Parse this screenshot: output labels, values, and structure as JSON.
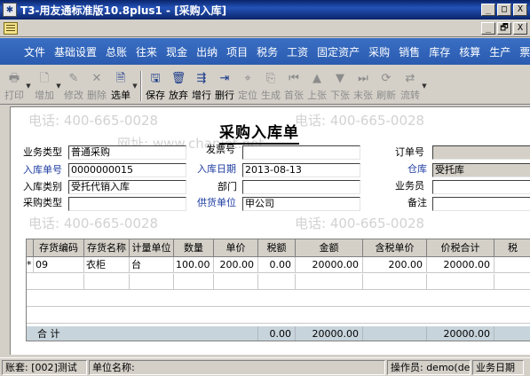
{
  "window": {
    "title": "T3-用友通标准版10.8plus1 - [采购入库]",
    "icon_name": "app-icon",
    "btn_min": "_",
    "btn_max": "□",
    "btn_close": "X"
  },
  "mdi": {
    "btn_min": "_",
    "btn_restore": "🗗",
    "btn_close": "X"
  },
  "menu": [
    "文件",
    "基础设置",
    "总账",
    "往来",
    "现金",
    "出纳",
    "项目",
    "税务",
    "工资",
    "固定资产",
    "采购",
    "销售",
    "库存",
    "核算",
    "生产",
    "票据"
  ],
  "toolbar": {
    "print": "打印",
    "add": "增加",
    "modify": "修改",
    "delete": "删除",
    "select": "选单",
    "save": "保存",
    "abandon": "放弃",
    "add_row": "增行",
    "delete_row": "删行",
    "locate": "定位",
    "generate": "生成",
    "first": "首张",
    "prev": "上张",
    "next": "下张",
    "last": "末张",
    "refresh": "刷新",
    "flow": "流转"
  },
  "watermark": {
    "phone": "电话: 400-665-0028",
    "site": "网址: www.chanjet.net"
  },
  "form": {
    "title": "采购入库单",
    "fields": {
      "business_type_label": "业务类型",
      "business_type_value": "普通采购",
      "invoice_no_label": "发票号",
      "invoice_no_value": "",
      "order_no_label": "订单号",
      "order_no_value": "",
      "receipt_no_label": "入库单号",
      "receipt_no_value": "0000000015",
      "receipt_date_label": "入库日期",
      "receipt_date_value": "2013-08-13",
      "warehouse_label": "仓库",
      "warehouse_value": "受托库",
      "receipt_category_label": "入库类别",
      "receipt_category_value": "受托代销入库",
      "department_label": "部门",
      "department_value": "",
      "salesperson_label": "业务员",
      "salesperson_value": "",
      "purchase_type_label": "采购类型",
      "purchase_type_value": "",
      "supplier_label": "供货单位",
      "supplier_value": "甲公司",
      "remark_label": "备注",
      "remark_value": ""
    }
  },
  "grid": {
    "columns": [
      "",
      "存货编码",
      "存货名称",
      "计量单位",
      "数量",
      "单价",
      "税额",
      "金额",
      "含税单价",
      "价税合计",
      "税"
    ],
    "rows": [
      [
        "*",
        "09",
        "衣柜",
        "台",
        "100.00",
        "200.00",
        "0.00",
        "20000.00",
        "200.00",
        "20000.00",
        ""
      ]
    ],
    "total": {
      "label": "合 计",
      "tax": "0.00",
      "amount": "20000.00",
      "total_with_tax": "20000.00"
    }
  },
  "status": {
    "account": "账套: [002]测试",
    "unit": "单位名称:",
    "operator": "操作员: demo(de",
    "business_date": "业务日期"
  }
}
